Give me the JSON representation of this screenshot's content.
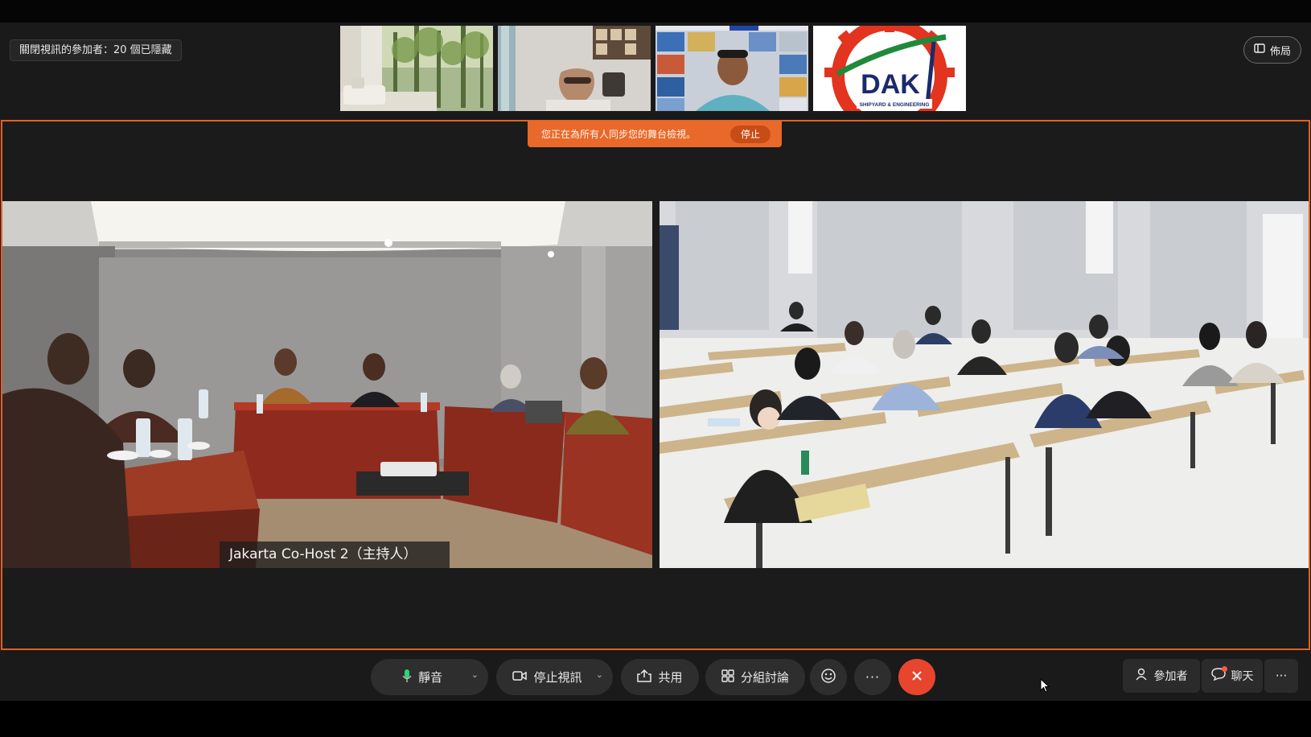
{
  "header": {
    "hidden_participants_label": "關閉視訊的參加者：20 個已隱藏",
    "layout_button_label": "佈局"
  },
  "thumbnails": [
    {
      "name": "participant-living-room"
    },
    {
      "name": "participant-man-glasses"
    },
    {
      "name": "participant-man-office"
    },
    {
      "name": "DAK",
      "logo_subtext": "SHIPYARD & ENGINEERING"
    }
  ],
  "stage": {
    "sync_banner_text": "您正在為所有人同步您的舞台檢視。",
    "stop_label": "停止",
    "left_video_label": "Jakarta Co-Host 2（主持人）"
  },
  "controls": {
    "mute_label": "靜音",
    "stop_video_label": "停止視訊",
    "share_label": "共用",
    "breakout_label": "分組討論",
    "participants_label": "參加者",
    "chat_label": "聊天"
  },
  "icons": {
    "mic": "microphone-icon",
    "video": "video-camera-icon",
    "share": "share-icon",
    "breakout": "breakout-rooms-icon",
    "reactions": "smiley-icon",
    "more": "ellipsis-icon",
    "end": "close-icon",
    "participants": "person-icon",
    "chat": "chat-bubble-icon",
    "layout": "grid-layout-icon"
  },
  "colors": {
    "stage_border": "#e0631e",
    "banner": "#e8692a",
    "end_call": "#e8452e",
    "mic_active": "#2ed573"
  }
}
